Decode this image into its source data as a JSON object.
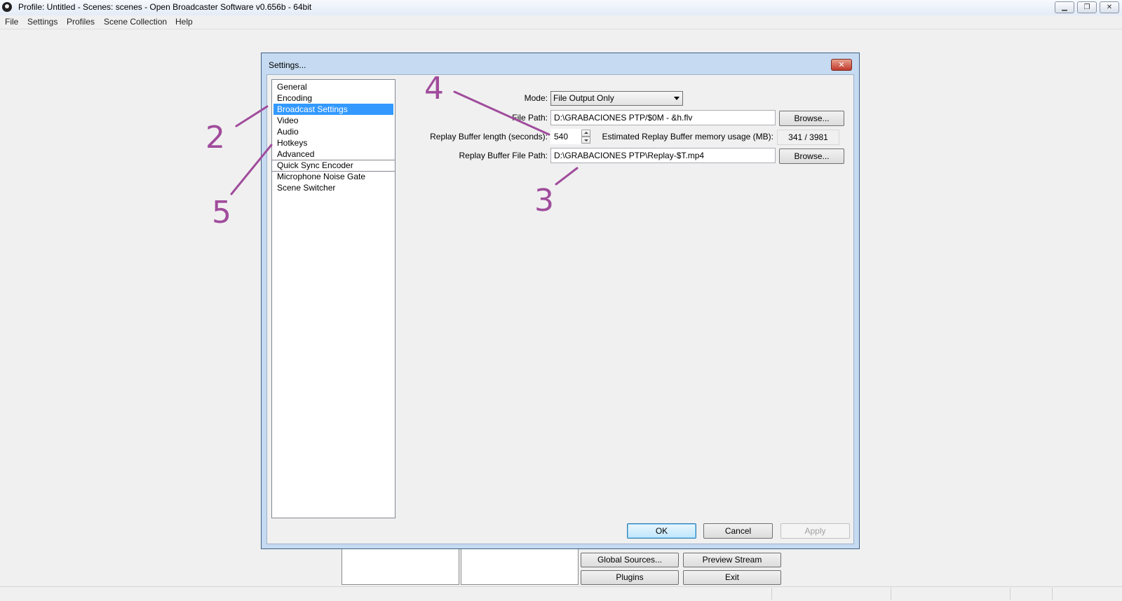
{
  "window": {
    "title": "Profile: Untitled - Scenes: scenes - Open Broadcaster Software v0.656b - 64bit",
    "minimize_glyph": "▁",
    "maximize_glyph": "❐",
    "close_glyph": "✕"
  },
  "menu": [
    "File",
    "Settings",
    "Profiles",
    "Scene Collection",
    "Help"
  ],
  "main_buttons": {
    "global_sources": "Global Sources...",
    "preview_stream": "Preview Stream",
    "plugins": "Plugins",
    "exit": "Exit"
  },
  "dialog": {
    "title": "Settings...",
    "close_glyph": "✕",
    "list_items": [
      "General",
      "Encoding",
      "Broadcast Settings",
      "Video",
      "Audio",
      "Hotkeys",
      "Advanced"
    ],
    "plugin_items": [
      "Quick Sync Encoder"
    ],
    "extra_items": [
      "Microphone Noise Gate",
      "Scene Switcher"
    ],
    "selected_item": "Broadcast Settings",
    "mode_label": "Mode:",
    "mode_value": "File Output Only",
    "file_path_label": "File Path:",
    "file_path_value": "D:\\GRABACIONES PTP/$0M - &h.flv",
    "browse_label": "Browse...",
    "replay_length_label": "Replay Buffer length (seconds):",
    "replay_length_value": "540",
    "memory_label": "Estimated Replay Buffer memory usage (MB):",
    "memory_value": "341 / 3981",
    "replay_path_label": "Replay Buffer File Path:",
    "replay_path_value": "D:\\GRABACIONES PTP\\Replay-$T.mp4",
    "ok": "OK",
    "cancel": "Cancel",
    "apply": "Apply"
  },
  "annotations": {
    "color": "#a04c9c",
    "n2": "2",
    "n3": "3",
    "n4": "4",
    "n5": "5"
  }
}
